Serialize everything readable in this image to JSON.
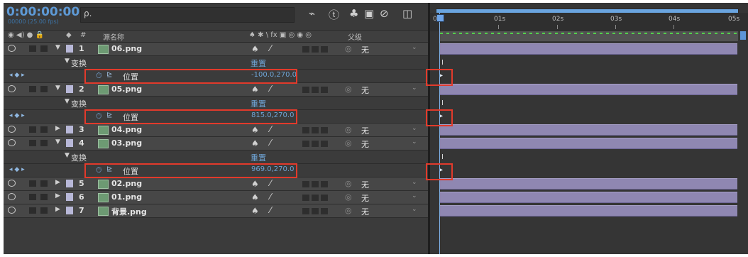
{
  "header": {
    "timecode": "0:00:00:00",
    "fps": "00000 (25.00 fps)",
    "search_icon": "search-icon",
    "toolbar_icons": [
      "compose-icon",
      "draft-3d-icon",
      "shy-layers-icon",
      "frame-blending-icon",
      "motion-blur-icon",
      "graph-editor-icon"
    ],
    "toolbar_glyphs": [
      "⌁",
      "ⓣ",
      "♣",
      "▣",
      "⊘",
      "◫"
    ]
  },
  "columns": {
    "av_switches": "◉ ◀) ● 🔒",
    "label": "◆",
    "number": "#",
    "source_name": "源名称",
    "switches": "♠ ✱ \\ fx ▣ ◎ ◉ ◎",
    "parent": "父级"
  },
  "rows": [
    {
      "type": "layer",
      "num": "1",
      "name": "06.png",
      "sw1": "♠",
      "sw2": "⁄",
      "parent": "无",
      "expanded": true
    },
    {
      "type": "transform",
      "label": "变换",
      "reset": "重置"
    },
    {
      "type": "property",
      "name": "位置",
      "value": "-100.0,270.0"
    },
    {
      "type": "layer",
      "num": "2",
      "name": "05.png",
      "sw1": "♠",
      "sw2": "⁄",
      "parent": "无",
      "expanded": true
    },
    {
      "type": "transform",
      "label": "变换",
      "reset": "重置"
    },
    {
      "type": "property",
      "name": "位置",
      "value": "815.0,270.0"
    },
    {
      "type": "layer",
      "num": "3",
      "name": "04.png",
      "sw1": "♠",
      "sw2": "⁄",
      "parent": "无",
      "expanded": false
    },
    {
      "type": "layer",
      "num": "4",
      "name": "03.png",
      "sw1": "♠",
      "sw2": "⁄",
      "parent": "无",
      "expanded": true
    },
    {
      "type": "transform",
      "label": "变换",
      "reset": "重置"
    },
    {
      "type": "property",
      "name": "位置",
      "value": "969.0,270.0"
    },
    {
      "type": "layer",
      "num": "5",
      "name": "02.png",
      "sw1": "♠",
      "sw2": "⁄",
      "parent": "无",
      "expanded": false
    },
    {
      "type": "layer",
      "num": "6",
      "name": "01.png",
      "sw1": "♠",
      "sw2": "⁄",
      "parent": "无",
      "expanded": false
    },
    {
      "type": "layer",
      "num": "7",
      "name": "背景.png",
      "sw1": "♠",
      "sw2": "⁄",
      "parent": "无",
      "expanded": false
    }
  ],
  "timeline": {
    "ticks": [
      "00s",
      "01s",
      "02s",
      "03s",
      "04s",
      "05s"
    ],
    "current_time_indicator": "playhead",
    "keyframe_glyph": "▸",
    "ibeam_glyph": "I"
  },
  "colors": {
    "highlight": "#e23a2b",
    "timecode": "#5e9ad6",
    "layer_bar": "#8f87b2",
    "accent": "#6fa4d6"
  }
}
